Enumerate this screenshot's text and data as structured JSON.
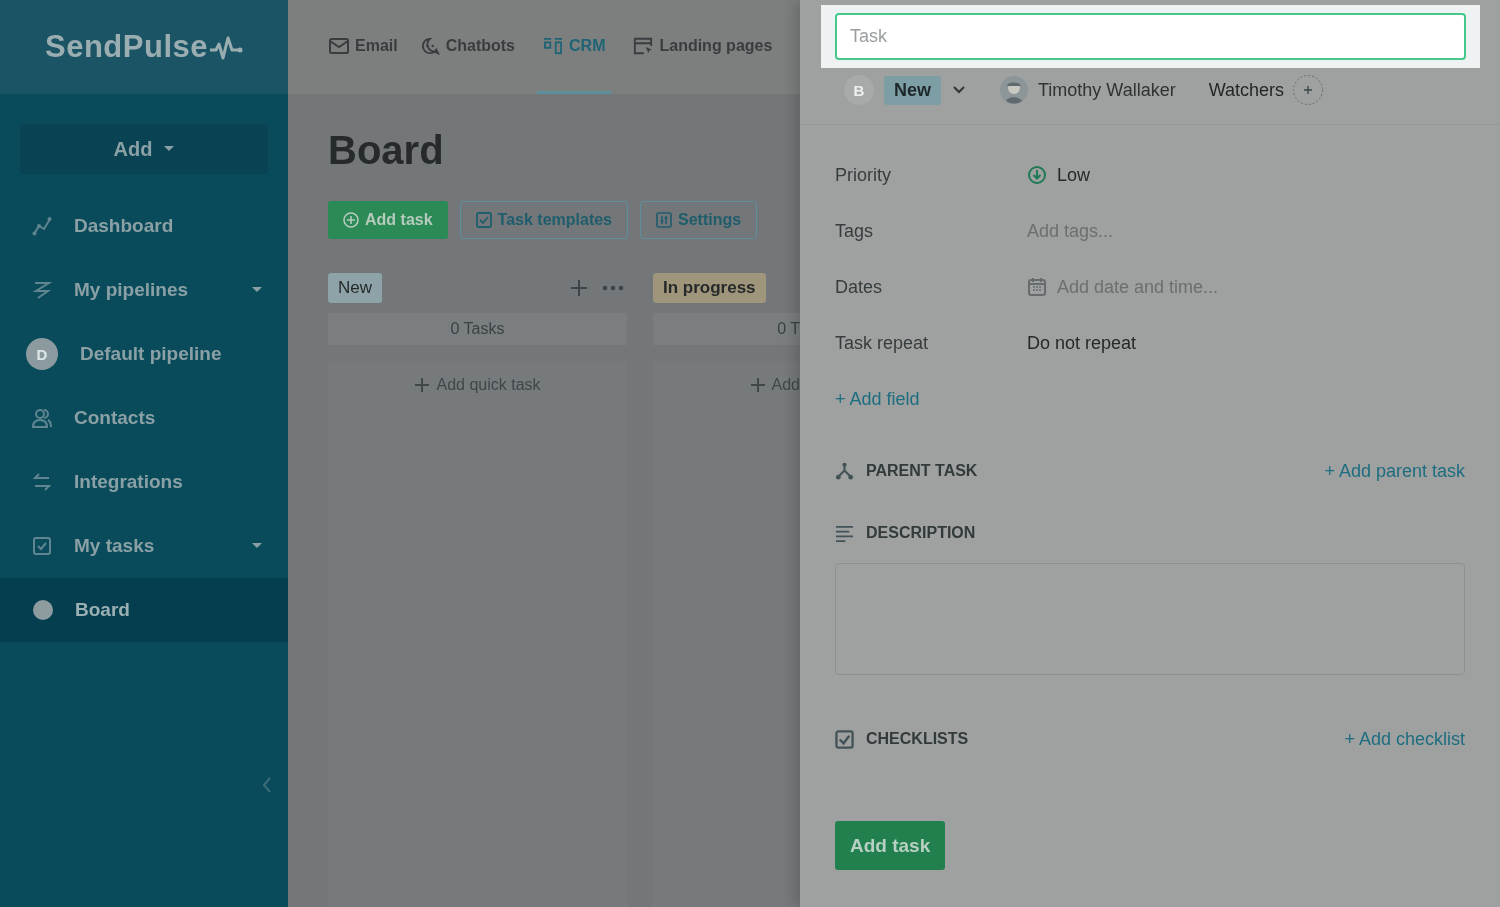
{
  "logo": {
    "text": "SendPulse"
  },
  "sidebar": {
    "add_button": "Add",
    "items": [
      {
        "label": "Dashboard",
        "kind": "icon",
        "expandable": false,
        "selected": false
      },
      {
        "label": "My pipelines",
        "kind": "icon",
        "expandable": true,
        "selected": false
      },
      {
        "label": "Default pipeline",
        "kind": "avatar",
        "initial": "D",
        "expandable": false,
        "selected": false
      },
      {
        "label": "Contacts",
        "kind": "icon",
        "expandable": false,
        "selected": false
      },
      {
        "label": "Integrations",
        "kind": "icon",
        "expandable": false,
        "selected": false
      },
      {
        "label": "My tasks",
        "kind": "icon",
        "expandable": true,
        "selected": false
      },
      {
        "label": "Board",
        "kind": "dot",
        "expandable": false,
        "selected": true
      }
    ]
  },
  "top_nav": [
    {
      "label": "Email",
      "selected": false
    },
    {
      "label": "Chatbots",
      "selected": false
    },
    {
      "label": "CRM",
      "selected": true
    },
    {
      "label": "Landing pages",
      "selected": false
    }
  ],
  "page": {
    "title": "Board",
    "buttons": [
      {
        "label": "Add task",
        "kind": "primary"
      },
      {
        "label": "Task templates",
        "kind": "outline"
      },
      {
        "label": "Settings",
        "kind": "outline"
      }
    ]
  },
  "columns": [
    {
      "name": "New",
      "color": "#8ea3a8",
      "actions": true,
      "count": "0 Tasks",
      "add": "Add quick task"
    },
    {
      "name": "In progress",
      "color": "#9e957a",
      "actions": false,
      "count": "0 T",
      "add": "Add"
    }
  ],
  "task_panel": {
    "task_field": {
      "placeholder": "Task"
    },
    "status": {
      "initial": "B",
      "stage": "New",
      "owner": "Timothy Wallaker",
      "watchers": "Watchers"
    },
    "fields": [
      {
        "label": "Priority",
        "value": "Low",
        "kind": "priority"
      },
      {
        "label": "Tags",
        "placeholder": "Add tags...",
        "kind": "hint"
      },
      {
        "label": "Dates",
        "placeholder": "Add date and time...",
        "kind": "date"
      },
      {
        "label": "Task repeat",
        "value": "Do not repeat",
        "kind": "text"
      }
    ],
    "add_field": "+ Add field",
    "sections": [
      {
        "title": "PARENT TASK",
        "kind": "parent",
        "action": "+ Add parent task"
      },
      {
        "title": "DESCRIPTION",
        "kind": "description"
      },
      {
        "title": "CHECKLISTS",
        "kind": "checklist",
        "action": "+ Add checklist"
      }
    ],
    "submit": "Add task"
  }
}
